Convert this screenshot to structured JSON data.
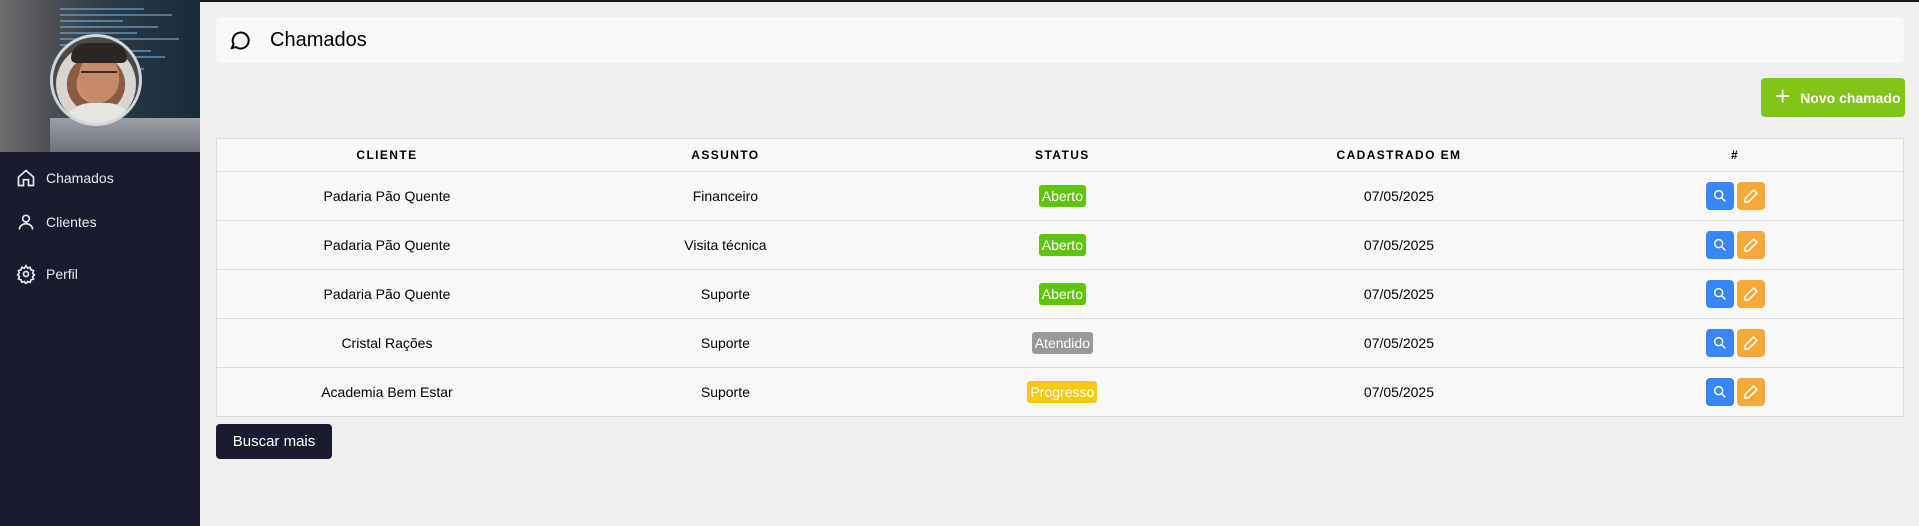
{
  "sidebar": {
    "items": [
      {
        "label": "Chamados",
        "icon": "home-icon"
      },
      {
        "label": "Clientes",
        "icon": "user-icon"
      },
      {
        "label": "Perfil",
        "icon": "gear-icon"
      }
    ]
  },
  "header": {
    "title": "Chamados",
    "icon": "chat-icon"
  },
  "actions": {
    "new_label": "Novo chamado",
    "more_label": "Buscar mais"
  },
  "table": {
    "columns": [
      "Cliente",
      "Assunto",
      "Status",
      "Cadastrado em",
      "#"
    ],
    "rows": [
      {
        "cliente": "Padaria Pão Quente",
        "assunto": "Financeiro",
        "status": "Aberto",
        "data": "07/05/2025"
      },
      {
        "cliente": "Padaria Pão Quente",
        "assunto": "Visita técnica",
        "status": "Aberto",
        "data": "07/05/2025"
      },
      {
        "cliente": "Padaria Pão Quente",
        "assunto": "Suporte",
        "status": "Aberto",
        "data": "07/05/2025"
      },
      {
        "cliente": "Cristal Rações",
        "assunto": "Suporte",
        "status": "Atendido",
        "data": "07/05/2025"
      },
      {
        "cliente": "Academia Bem Estar",
        "assunto": "Suporte",
        "status": "Progresso",
        "data": "07/05/2025"
      }
    ]
  },
  "colors": {
    "sidebar_bg": "#181c2e",
    "new_button": "#83c418",
    "status_aberto": "#5fc50c",
    "status_atendido": "#999999",
    "status_progresso": "#f7c915",
    "search_button": "#3b86f6",
    "edit_button": "#f6a93b"
  }
}
